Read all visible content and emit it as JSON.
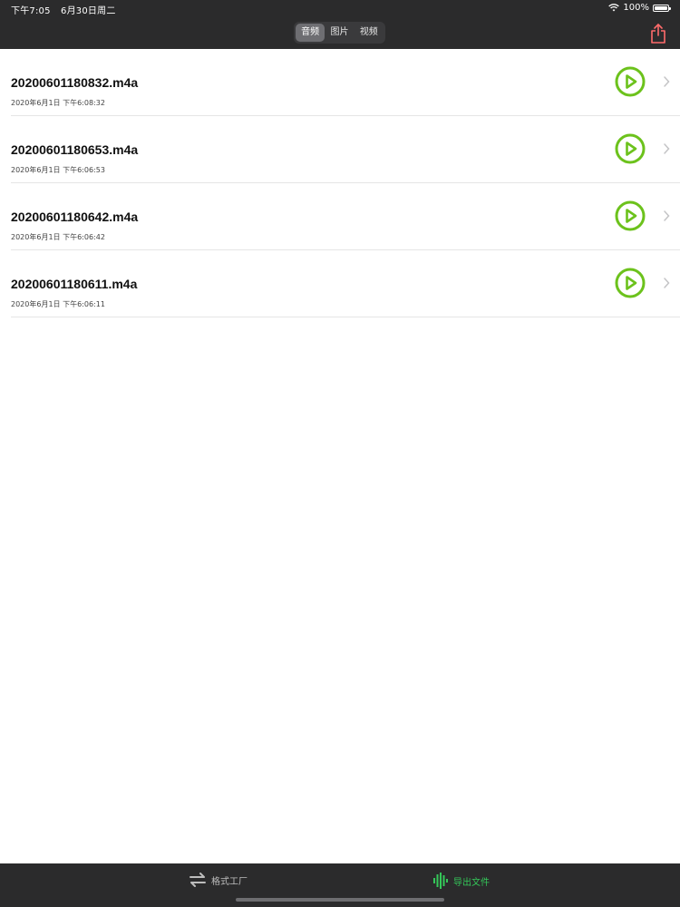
{
  "status": {
    "time": "下午7:05",
    "date": "6月30日周二",
    "battery": "100%"
  },
  "segments": [
    {
      "label": "音频",
      "active": true
    },
    {
      "label": "图片",
      "active": false
    },
    {
      "label": "视频",
      "active": false
    }
  ],
  "files": [
    {
      "name": "20200601180832.m4a",
      "date": "2020年6月1日 下午6:08:32"
    },
    {
      "name": "20200601180653.m4a",
      "date": "2020年6月1日 下午6:06:53"
    },
    {
      "name": "20200601180642.m4a",
      "date": "2020年6月1日 下午6:06:42"
    },
    {
      "name": "20200601180611.m4a",
      "date": "2020年6月1日 下午6:06:11"
    }
  ],
  "tabs": [
    {
      "label": "格式工厂",
      "icon": "swap-arrows-icon",
      "active": false
    },
    {
      "label": "导出文件",
      "icon": "waveform-icon",
      "active": true
    }
  ],
  "colors": {
    "accent": "#34c759",
    "play": "#6cc21c",
    "share": "#ff6b6b",
    "bar": "#2b2b2c"
  }
}
